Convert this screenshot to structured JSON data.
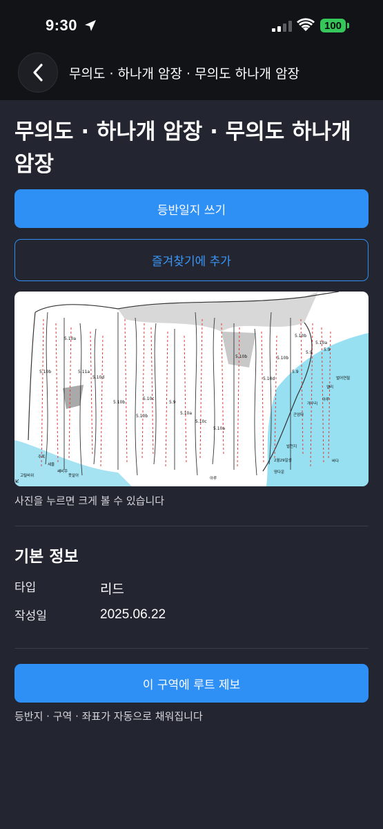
{
  "status_bar": {
    "time": "9:30",
    "battery": "100"
  },
  "nav": {
    "title": "무의도 · 하나개 암장 · 무의도 하나개 암장"
  },
  "page": {
    "title": "무의도 · 하나개 암장 · 무의도 하나개 암장"
  },
  "actions": {
    "write_log_label": "등반일지 쓰기",
    "add_favorite_label": "즐겨찾기에 추가"
  },
  "topo": {
    "caption": "사진을 누르면 크게 볼 수 있습니다",
    "grade_labels": [
      "5.10b",
      "5.10a",
      "5.11a",
      "5.10d",
      "5.10b",
      "5.10b",
      "5.10c",
      "5.9",
      "5.10a",
      "5.10c",
      "5.10a",
      "5.10b",
      "5.10d",
      "5.10b",
      "5.9",
      "5.10b",
      "5.9",
      "5.10a",
      "5.9"
    ],
    "place_labels": [
      "주목",
      "세울",
      "쎄비주",
      "못살아",
      "고릴바위",
      "아루",
      "벌천지",
      "2월29일생",
      "땅다운",
      "곤엄마",
      "개구리",
      "아루",
      "엘리",
      "벌어연필",
      "바다"
    ]
  },
  "info": {
    "section_title": "기본 정보",
    "rows": [
      {
        "label": "타입",
        "value": "리드"
      },
      {
        "label": "작성일",
        "value": "2025.06.22"
      }
    ]
  },
  "submit": {
    "label": "이 구역에 루트 제보",
    "note": "등반지 · 구역 · 좌표가 자동으로 채워집니다"
  },
  "colors": {
    "background": "#232530",
    "accent": "#2e8ff5",
    "bar": "#121316"
  }
}
